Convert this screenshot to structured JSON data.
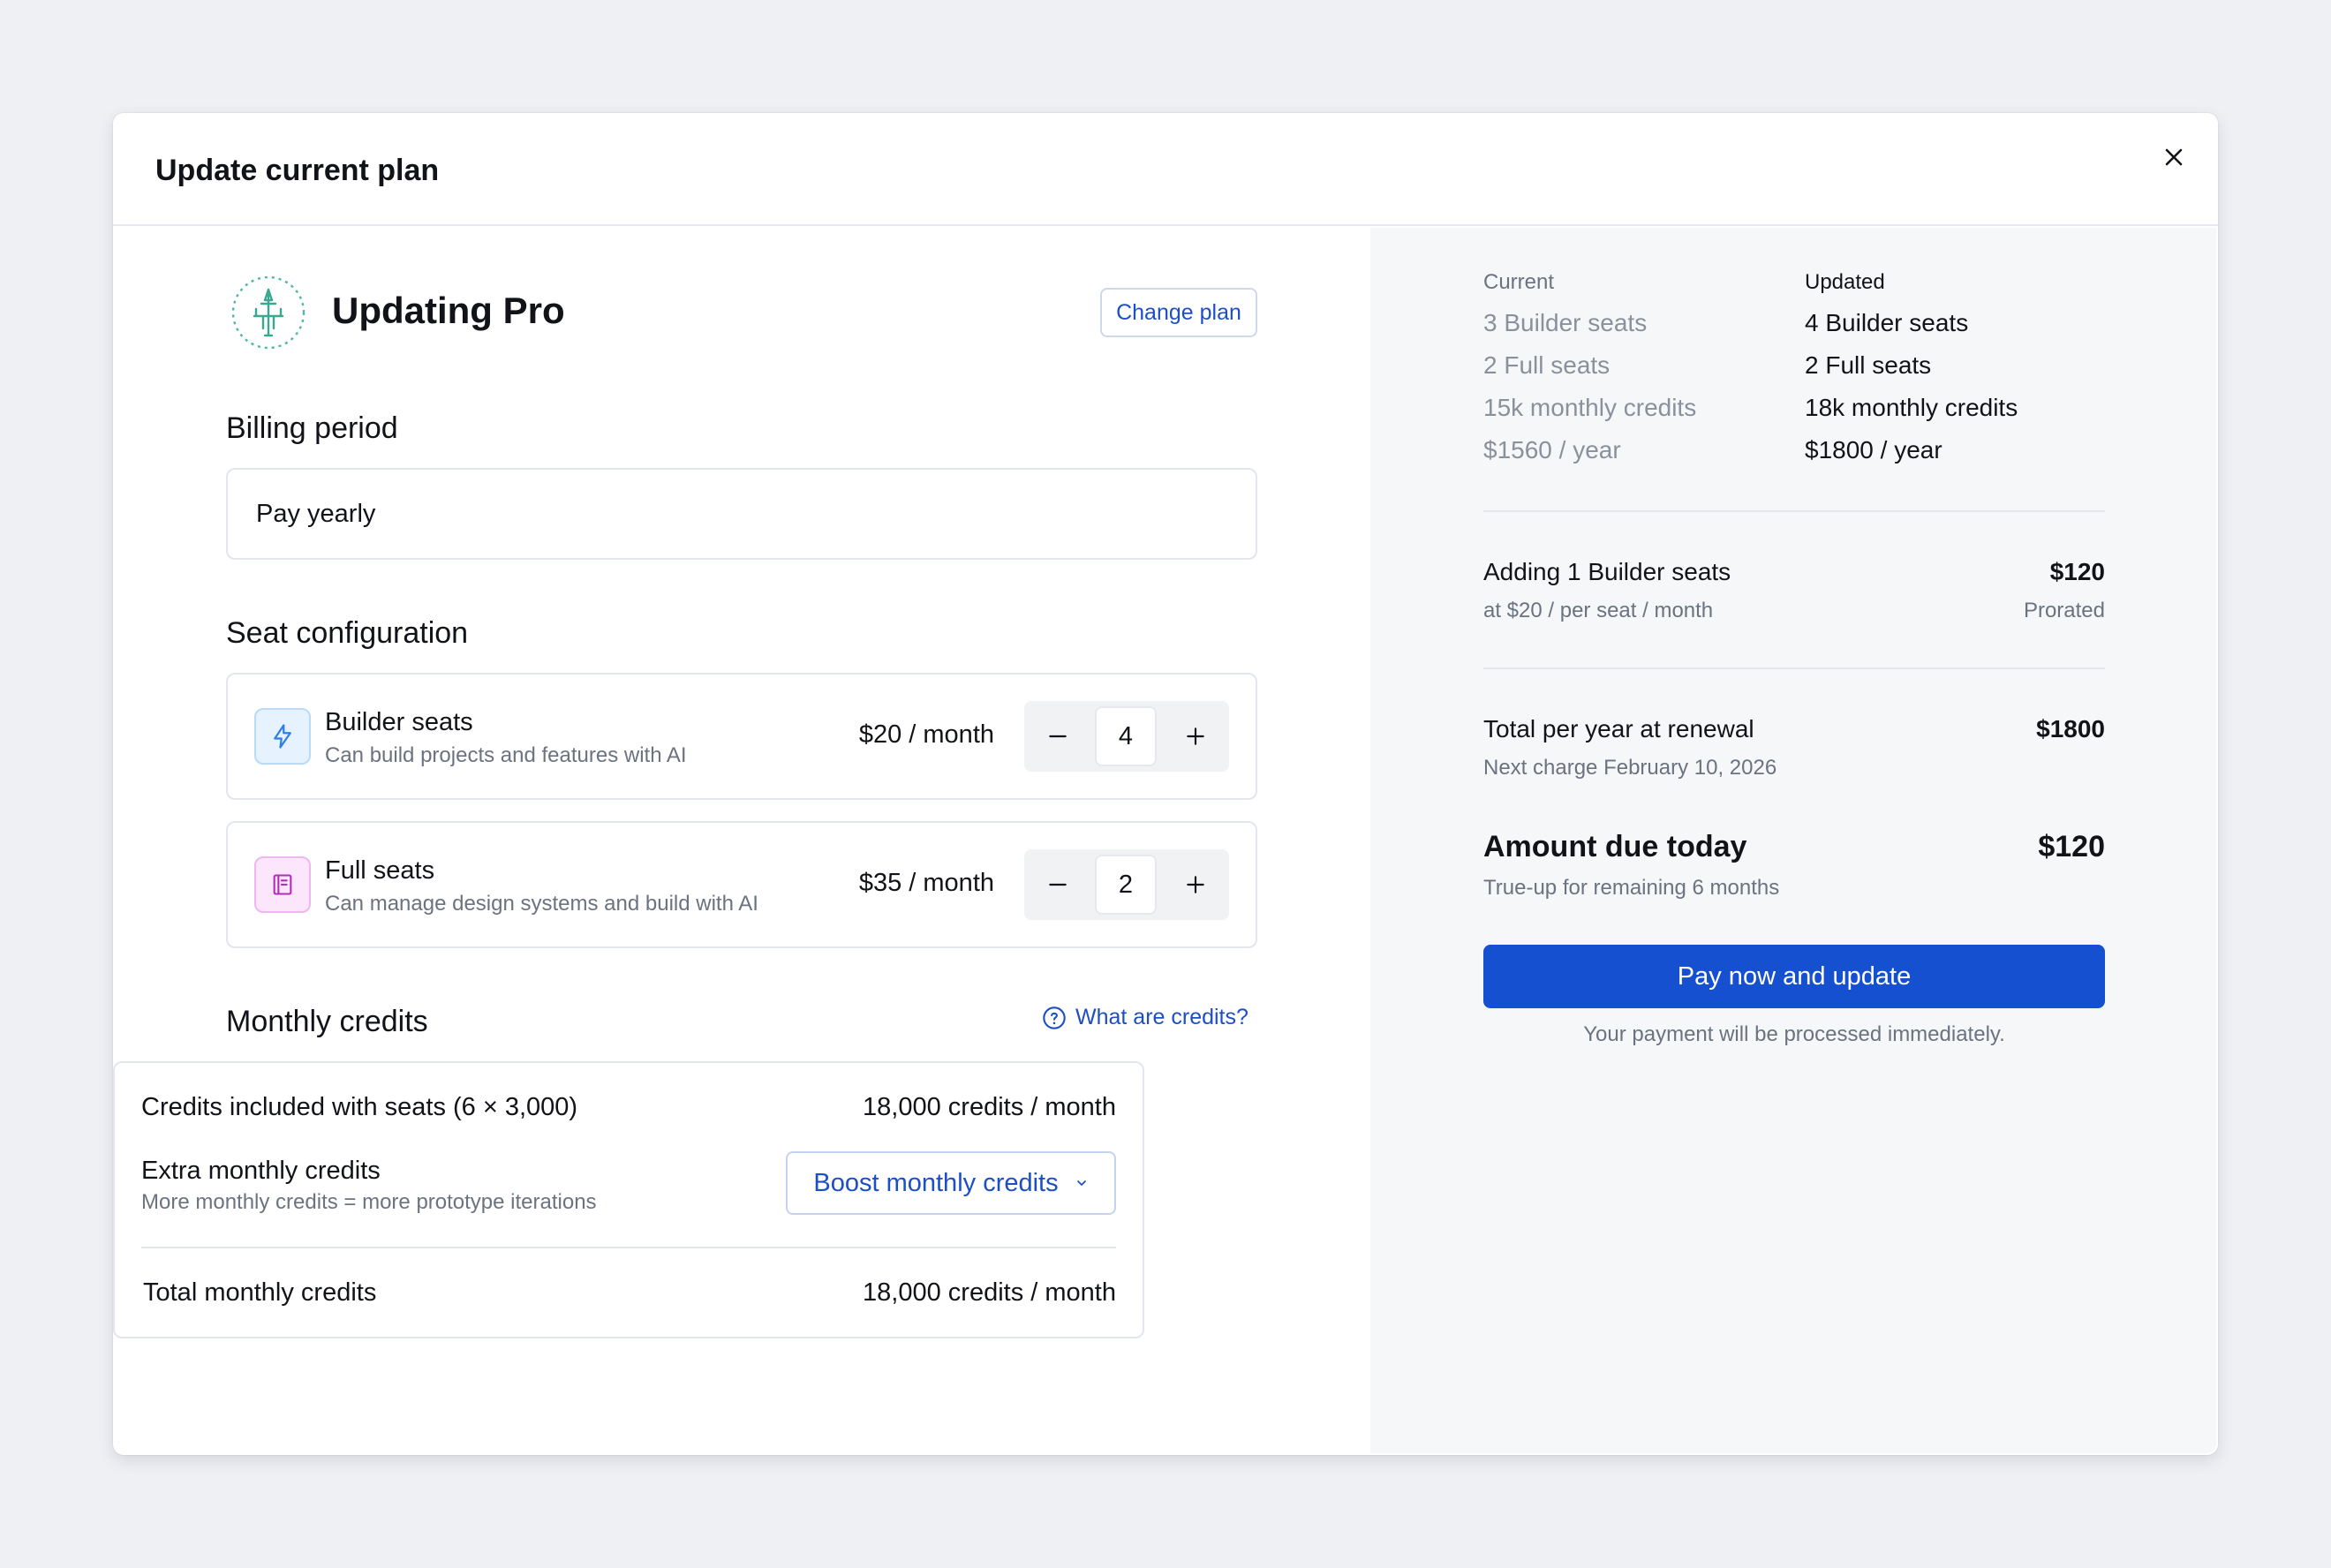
{
  "modal": {
    "title": "Update current plan"
  },
  "plan": {
    "title": "Updating Pro",
    "change_label": "Change plan"
  },
  "billing": {
    "section_title": "Billing period",
    "value": "Pay yearly"
  },
  "seats": {
    "section_title": "Seat configuration",
    "items": [
      {
        "name": "Builder seats",
        "description": "Can build projects and features with AI",
        "price": "$20 / month",
        "count": "4",
        "icon": "bolt-icon",
        "icon_color": "#2f7fe6",
        "icon_bg": "#e6f2fd"
      },
      {
        "name": "Full seats",
        "description": "Can manage design systems and build with AI",
        "price": "$35 / month",
        "count": "2",
        "icon": "book-icon",
        "icon_color": "#b12fb8",
        "icon_bg": "#fbe6fb"
      }
    ]
  },
  "credits": {
    "section_title": "Monthly credits",
    "help_label": "What are credits?",
    "included_label": "Credits included with seats (6 × 3,000)",
    "included_value": "18,000 credits / month",
    "extra_label": "Extra monthly credits",
    "extra_sub": "More monthly credits = more prototype iterations",
    "boost_label": "Boost monthly credits",
    "total_label": "Total monthly credits",
    "total_value": "18,000 credits / month"
  },
  "comparison": {
    "current_header": "Current",
    "updated_header": "Updated",
    "current": [
      "3 Builder seats",
      "2 Full seats",
      "15k monthly credits",
      "$1560 / year"
    ],
    "updated": [
      "4 Builder seats",
      "2 Full seats",
      "18k monthly credits",
      "$1800 / year"
    ]
  },
  "summary": {
    "adding_label": "Adding 1 Builder seats",
    "adding_sub": "at $20 / per seat / month",
    "adding_value": "$120",
    "adding_value_sub": "Prorated",
    "renewal_label": "Total per year at renewal",
    "renewal_sub": "Next charge February 10, 2026",
    "renewal_value": "$1800",
    "due_label": "Amount due today",
    "due_sub": "True-up for remaining 6 months",
    "due_value": "$120",
    "pay_label": "Pay now and update",
    "pay_note": "Your payment will be processed immediately."
  },
  "colors": {
    "accent": "#1550d0",
    "link": "#1d4fc4",
    "page_bg": "#eff0f4",
    "panel_bg": "#f6f7f9"
  }
}
